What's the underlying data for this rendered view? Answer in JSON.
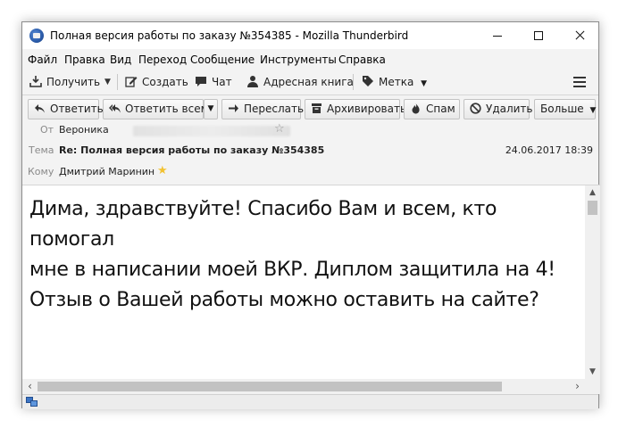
{
  "window": {
    "title": "Полная версия работы по заказу №354385 - Mozilla Thunderbird"
  },
  "menu": {
    "items": [
      "Файл",
      "Правка",
      "Вид",
      "Переход",
      "Сообщение",
      "Инструменты",
      "Справка"
    ]
  },
  "toolbar": {
    "get_mail": "Получить",
    "compose": "Создать",
    "chat": "Чат",
    "address_book": "Адресная книга",
    "tag": "Метка"
  },
  "actions": {
    "reply": "Ответить",
    "reply_all": "Ответить всем",
    "forward": "Переслать",
    "archive": "Архивировать",
    "junk": "Спам",
    "delete": "Удалить",
    "more": "Больше"
  },
  "header": {
    "from_label": "От",
    "from_value": "Вероника",
    "subject_label": "Тема",
    "subject_value": "Re: Полная версия работы по заказу №354385",
    "date": "24.06.2017 18:39",
    "to_label": "Кому",
    "to_value": "Дмитрий Маринин"
  },
  "body": {
    "lines": [
      "Дима, здравствуйте! Спасибо Вам и всем, кто помогал",
      "мне в написании моей ВКР. Диплом защитила на 4!",
      "Отзыв о Вашей работы можно оставить на сайте?"
    ]
  },
  "icons": {
    "app": "thunderbird-icon",
    "get_mail": "download-icon",
    "compose": "pencil-icon",
    "chat": "chat-bubble-icon",
    "address_book": "person-icon",
    "tag": "tag-icon",
    "menu": "hamburger-icon",
    "reply": "reply-arrow-icon",
    "reply_all": "reply-all-icon",
    "forward": "forward-arrow-icon",
    "archive": "archive-box-icon",
    "junk": "flame-icon",
    "delete": "no-sign-icon",
    "star": "star-icon",
    "status": "network-icon"
  },
  "colors": {
    "star_active": "#f2c232",
    "star_inactive": "#9a9a9a",
    "label_gray": "#8a8a8a"
  }
}
